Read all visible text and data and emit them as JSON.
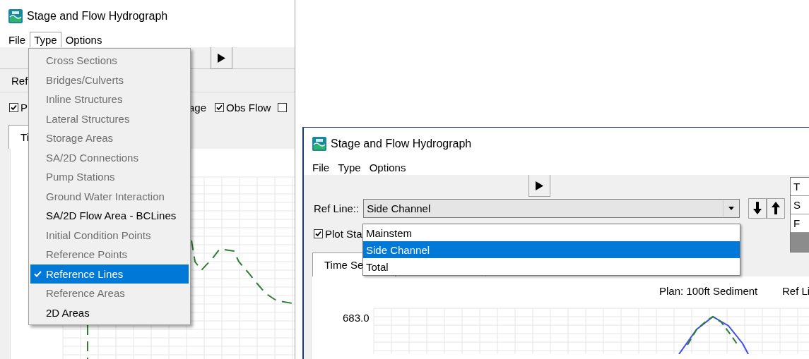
{
  "left_window": {
    "title": "Stage and Flow Hydrograph",
    "menu": [
      {
        "label": "File",
        "selected": false
      },
      {
        "label": "Type",
        "selected": true
      },
      {
        "label": "Options",
        "selected": false
      }
    ],
    "ref_label": "Ref",
    "options_row": [
      {
        "kind": "checkbox",
        "label": "P",
        "checked": true
      },
      {
        "kind": "text",
        "label": "age"
      },
      {
        "kind": "checkbox",
        "label": "Obs Flow",
        "checked": true
      },
      {
        "kind": "checkbox",
        "checked": false
      }
    ],
    "tab": {
      "label": "Ti",
      "selected": true
    },
    "type_menu": [
      {
        "label": "Cross Sections",
        "disabled": true,
        "checked": false,
        "selected": false
      },
      {
        "label": "Bridges/Culverts",
        "disabled": true,
        "checked": false,
        "selected": false
      },
      {
        "label": "Inline Structures",
        "disabled": true,
        "checked": false,
        "selected": false
      },
      {
        "label": "Lateral Structures",
        "disabled": true,
        "checked": false,
        "selected": false
      },
      {
        "label": "Storage Areas",
        "disabled": true,
        "checked": false,
        "selected": false
      },
      {
        "label": "SA/2D Connections",
        "disabled": true,
        "checked": false,
        "selected": false
      },
      {
        "label": "Pump Stations",
        "disabled": true,
        "checked": false,
        "selected": false
      },
      {
        "label": "Ground Water Interaction",
        "disabled": true,
        "checked": false,
        "selected": false
      },
      {
        "label": "SA/2D Flow Area - BCLines",
        "disabled": false,
        "checked": false,
        "selected": false
      },
      {
        "label": "Initial Condition Points",
        "disabled": true,
        "checked": false,
        "selected": false
      },
      {
        "label": "Reference Points",
        "disabled": true,
        "checked": false,
        "selected": false
      },
      {
        "label": "Reference Lines",
        "disabled": false,
        "checked": true,
        "selected": true
      },
      {
        "label": "Reference Areas",
        "disabled": true,
        "checked": false,
        "selected": false
      },
      {
        "label": "2D Areas",
        "disabled": false,
        "checked": false,
        "selected": false
      }
    ]
  },
  "right_window": {
    "title": "Stage and Flow Hydrograph",
    "menu": [
      {
        "label": "File",
        "selected": false
      },
      {
        "label": "Type",
        "selected": false
      },
      {
        "label": "Options",
        "selected": false
      }
    ],
    "ref_line": {
      "label": "Ref Line::",
      "value": "Side Channel",
      "options": [
        {
          "label": "Mainstem",
          "selected": false
        },
        {
          "label": "Side Channel",
          "selected": true
        },
        {
          "label": "Total",
          "selected": false
        }
      ]
    },
    "side_table": [
      "T",
      "S",
      "F"
    ],
    "plot_checkbox": {
      "label": "Plot Sta",
      "checked": true
    },
    "tab": {
      "label": "Time Se",
      "selected": true
    },
    "plan_label": "Plan: 100ft Sediment",
    "ref_label": "Ref Li",
    "y_tick": "683.0"
  }
}
